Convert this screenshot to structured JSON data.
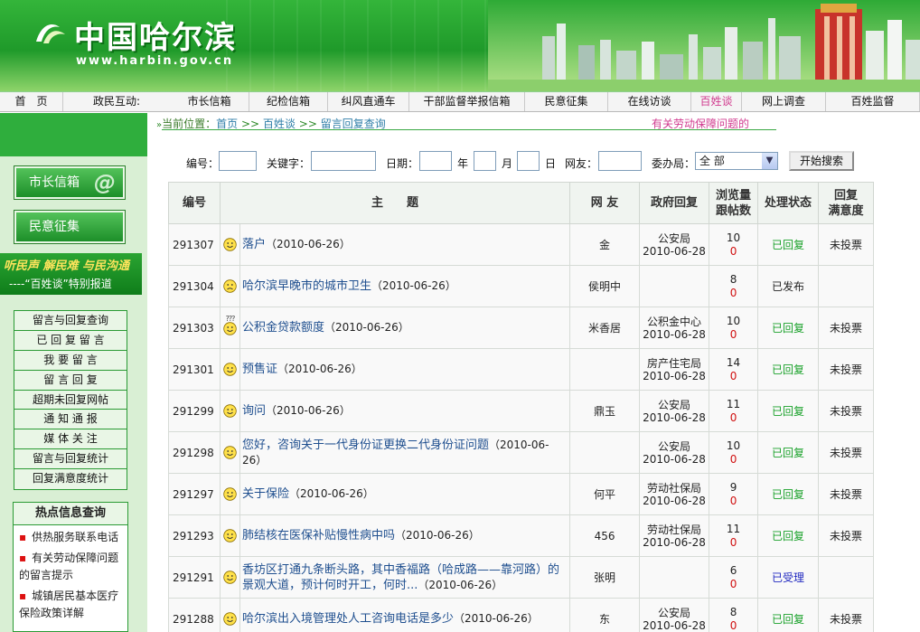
{
  "header": {
    "title": "中国哈尔滨",
    "url": "www.harbin.gov.cn"
  },
  "nav": {
    "items": [
      {
        "label": "首　页",
        "w": 70
      },
      {
        "label": "政民互动:",
        "w": 118
      },
      {
        "label": "市长信箱",
        "w": 88
      },
      {
        "label": "纪检信箱",
        "w": 87
      },
      {
        "label": "纠风直通车",
        "w": 90
      },
      {
        "label": "干部监督举报信箱",
        "w": 128
      },
      {
        "label": "民意征集",
        "w": 92
      },
      {
        "label": "在线访谈",
        "w": 92
      },
      {
        "label": "百姓谈",
        "w": 56
      },
      {
        "label": "网上调查",
        "w": 93
      },
      {
        "label": "百姓监督",
        "w": 104
      }
    ],
    "active": "百姓谈"
  },
  "sidebar": {
    "btn_mayor": "市长信箱",
    "btn_opinion": "民意征集",
    "slogan_line1": "听民声 解民难 与民沟通",
    "slogan_line2": "----“百姓谈”特别报道",
    "list": [
      "留言与回复查询",
      "已 回 复 留 言",
      "我 要 留 言",
      "留 言 回 复",
      "超期未回复网帖",
      "通 知 通 报",
      "媒 体 关 注",
      "留言与回复统计",
      "回复满意度统计"
    ],
    "hot_title": "热点信息查询",
    "hot_items": [
      "供热服务联系电话",
      "有关劳动保障问题的留言提示",
      "城镇居民基本医疗保险政策详解"
    ]
  },
  "breadcrumb": {
    "prefix": "当前位置：",
    "home": "首页",
    "sep": ">>",
    "level1": "百姓谈",
    "level2": "留言回复查询",
    "marquee": "有关劳动保障问题的"
  },
  "search": {
    "id_label": "编号：",
    "keyword_label": "关键字：",
    "date_label": "日期：",
    "year": "年",
    "month": "月",
    "day": "日",
    "user_label": "网友：",
    "bureau_label": "委办局：",
    "bureau_value": "全 部",
    "button": "开始搜索"
  },
  "table": {
    "headers": {
      "id": "编号",
      "topic": "主　　题",
      "user": "网 友",
      "gov": "政府回复",
      "views_1": "浏览量",
      "views_2": "跟帖数",
      "status": "处理状态",
      "satisfaction_1": "回复",
      "satisfaction_2": "满意度"
    },
    "rows": [
      {
        "id": "291307",
        "face": "smile",
        "topic": "落户",
        "date": "（2010-06-26）",
        "user": "金",
        "gov": "公安局",
        "gov_date": "2010-06-28",
        "views": "10",
        "replies": "0",
        "status": "已回复",
        "status_color": "#1aa12a",
        "vote": "未投票"
      },
      {
        "id": "291304",
        "face": "sad",
        "topic": "哈尔滨早晚市的城市卫生",
        "date": "（2010-06-26）",
        "user": "侯明中",
        "gov": "",
        "gov_date": "",
        "views": "8",
        "replies": "0",
        "status": "已发布",
        "status_color": "#222222",
        "vote": ""
      },
      {
        "id": "291303",
        "face": "question",
        "topic": "公积金贷款额度",
        "date": "（2010-06-26）",
        "user": "米香居",
        "gov": "公积金中心",
        "gov_date": "2010-06-28",
        "views": "10",
        "replies": "0",
        "status": "已回复",
        "status_color": "#1aa12a",
        "vote": "未投票"
      },
      {
        "id": "291301",
        "face": "smile",
        "topic": "预售证",
        "date": "（2010-06-26）",
        "user": "",
        "gov": "房产住宅局",
        "gov_date": "2010-06-28",
        "views": "14",
        "replies": "0",
        "status": "已回复",
        "status_color": "#1aa12a",
        "vote": "未投票"
      },
      {
        "id": "291299",
        "face": "smile",
        "topic": "询问",
        "date": "（2010-06-26）",
        "user": "鼎玉",
        "gov": "公安局",
        "gov_date": "2010-06-28",
        "views": "11",
        "replies": "0",
        "status": "已回复",
        "status_color": "#1aa12a",
        "vote": "未投票"
      },
      {
        "id": "291298",
        "face": "smile",
        "topic": "您好，咨询关于一代身份证更换二代身份证问题",
        "date": "（2010-06-26）",
        "user": "",
        "gov": "公安局",
        "gov_date": "2010-06-28",
        "views": "10",
        "replies": "0",
        "status": "已回复",
        "status_color": "#1aa12a",
        "vote": "未投票"
      },
      {
        "id": "291297",
        "face": "smile",
        "topic": "关于保险",
        "date": "（2010-06-26）",
        "user": "何平",
        "gov": "劳动社保局",
        "gov_date": "2010-06-28",
        "views": "9",
        "replies": "0",
        "status": "已回复",
        "status_color": "#1aa12a",
        "vote": "未投票"
      },
      {
        "id": "291293",
        "face": "smile",
        "topic": "肺结核在医保补贴慢性病中吗",
        "date": "（2010-06-26）",
        "user": "456",
        "gov": "劳动社保局",
        "gov_date": "2010-06-28",
        "views": "11",
        "replies": "0",
        "status": "已回复",
        "status_color": "#1aa12a",
        "vote": "未投票"
      },
      {
        "id": "291291",
        "face": "smile",
        "topic": "香坊区打通九条断头路，其中香福路（哈成路——靠河路）的景观大道，预计何时开工，何时...",
        "date": "（2010-06-26）",
        "user": "张明",
        "gov": "",
        "gov_date": "",
        "views": "6",
        "replies": "0",
        "status": "已受理",
        "status_color": "#2028c0",
        "vote": ""
      },
      {
        "id": "291288",
        "face": "smile",
        "topic": "哈尔滨出入境管理处人工咨询电话是多少",
        "date": "（2010-06-26）",
        "user": "东",
        "gov": "公安局",
        "gov_date": "2010-06-28",
        "views": "8",
        "replies": "0",
        "status": "已回复",
        "status_color": "#1aa12a",
        "vote": "未投票"
      }
    ]
  }
}
